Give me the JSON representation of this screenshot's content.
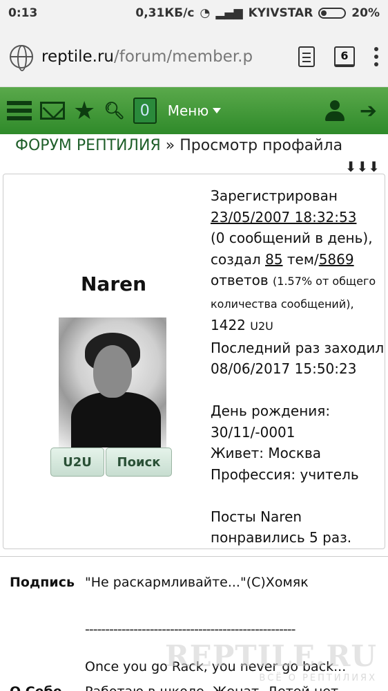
{
  "status_bar": {
    "time": "0:13",
    "speed": "0,31КБ/с",
    "carrier": "KYIVSTAR",
    "battery": "20%"
  },
  "browser": {
    "url_domain": "reptile.ru",
    "url_path": "/forum/member.pl",
    "tabs_count": "6"
  },
  "forum_nav": {
    "inbox_count": "0",
    "menu_label": "Меню"
  },
  "breadcrumb": {
    "forum": "ФОРУМ РЕПТИЛИЯ",
    "rest": " » Просмотр профайла",
    "arrows": "⬇⬇⬇"
  },
  "profile": {
    "name": "Naren",
    "buttons": {
      "u2u": "U2U",
      "search": "Поиск"
    },
    "registered_label": "Зарегистрирован",
    "registered_date": "23/05/2007 18:32:53",
    "per_day": "(0 сообщений в день),",
    "created_prefix": "создал ",
    "threads": "85",
    "threads_suffix": " тем/",
    "replies": "5869",
    "replies_word": "ответов ",
    "replies_percent": "(1.57% от общего количества сообщений),",
    "u2u_count": "1422",
    "u2u_label": "U2U",
    "last_visit_label": "Последний раз заходил",
    "last_visit_date": "08/06/2017 15:50:23",
    "birthday_label": "День рождения:",
    "birthday": "30/11/-0001",
    "lives": "Живет: Москва",
    "profession": "Профессия: учитель",
    "likes_line1": "Посты Naren",
    "likes_line2": "понравились 5 раз."
  },
  "signature": {
    "label": "Подпись",
    "line1": "\"Не раскармливайте...\"(С)Хомяк",
    "dashes": "----------------------------------------------------",
    "line2": "Once you go Rack, you never go back..."
  },
  "about": {
    "label": "О Себе",
    "text": "Работаю в школе. Женат. Детей нет"
  },
  "watermark": {
    "logo": "REPTILE.RU",
    "tagline": "ВСЁ О РЕПТИЛИЯХ"
  }
}
